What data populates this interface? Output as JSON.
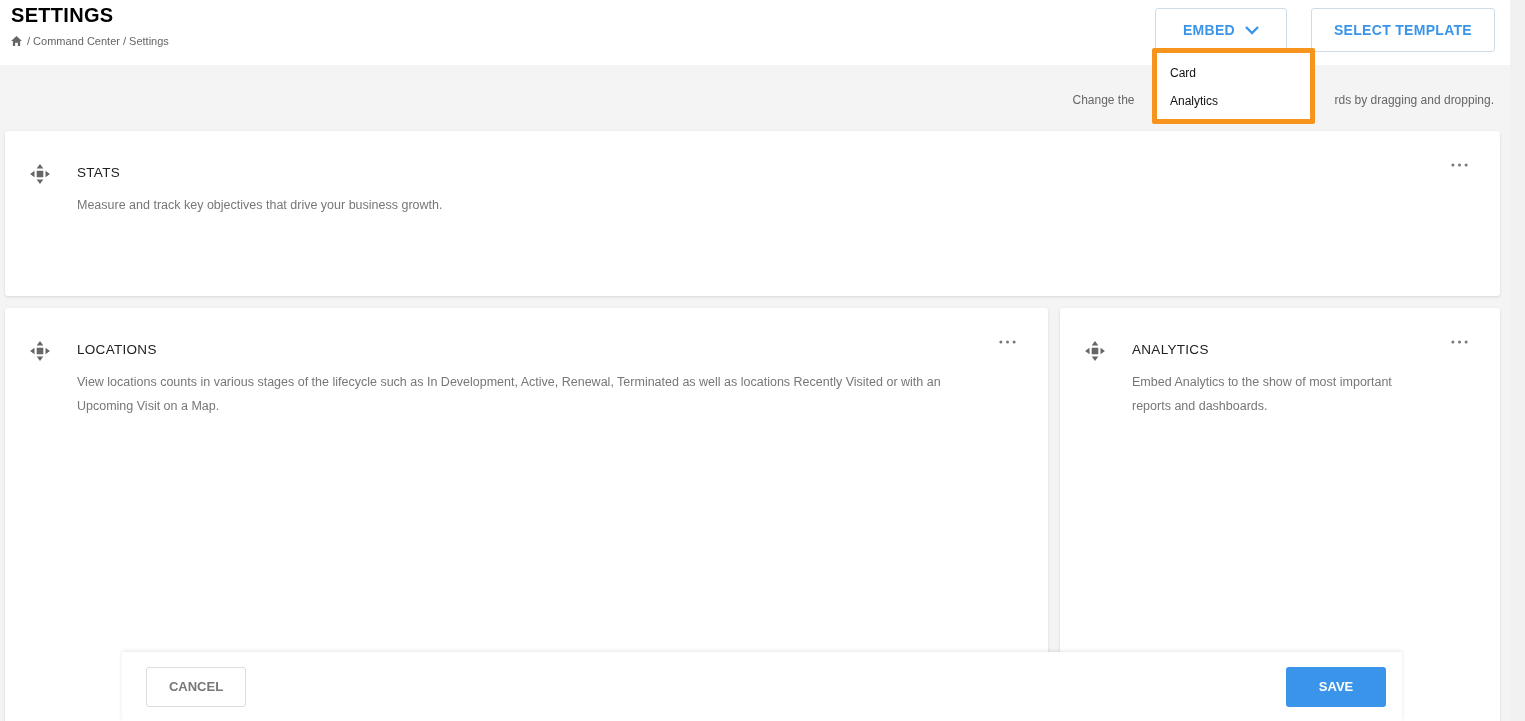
{
  "header": {
    "title": "SETTINGS",
    "breadcrumb": [
      "/ Command Center / Settings"
    ],
    "embed_button": {
      "label": "EMBED",
      "expanded": true
    },
    "template_button": "SELECT TEMPLATE"
  },
  "dropdown": {
    "items": [
      {
        "label": "Card"
      },
      {
        "label": "Analytics"
      }
    ]
  },
  "hint": [
    "Change the",
    "rds by dragging and dropping."
  ],
  "cards": [
    {
      "title": "STATS",
      "description": "Measure and track key objectives that drive your business growth.",
      "kind": "full"
    },
    {
      "title": "LOCATIONS",
      "description": "View locations counts in various stages of the lifecycle such as In Development, Active, Renewal, Terminated as well as locations Recently Visited or with an Upcoming Visit on a Map.",
      "kind": "wide"
    },
    {
      "title": "ANALYTICS",
      "description": "Embed Analytics to the show of most important reports and dashboards.",
      "kind": "narrow"
    }
  ],
  "footer": {
    "cancel": "CANCEL",
    "save": "SAVE"
  }
}
